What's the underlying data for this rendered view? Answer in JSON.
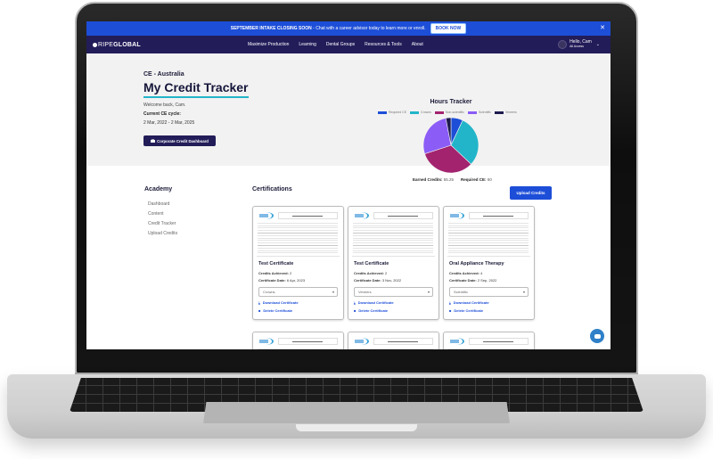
{
  "promo": {
    "headline": "SEPTEMBER INTAKE CLOSING SOON",
    "message": " - Chat with a career advisor today to learn more or enroll.",
    "cta": "BOOK NOW",
    "close": "✕"
  },
  "nav": {
    "logo_light": "RIPE",
    "logo_bold": "GLOBAL",
    "links": [
      "Maximize Production",
      "Learning",
      "Dental Groups",
      "Resources & Tools",
      "About"
    ],
    "user_greeting": "Hello, Cam",
    "user_sub": "All Access",
    "chevron": "⌄"
  },
  "hero": {
    "subtitle": "CE - Australia",
    "title": "My Credit Tracker",
    "welcome": "Welcome back, Cam.",
    "cycle_label": "Current CE cycle:",
    "cycle_value": "2 Mar, 2022 - 2 Mar, 2025",
    "dashboard_button": "Corporate Credit Dashboard"
  },
  "tracker": {
    "earned_label": "Earned Credits:",
    "earned_value": "55.25",
    "required_label": "Required CE:",
    "required_value": "60"
  },
  "chart_data": {
    "type": "pie",
    "title": "Hours Tracker",
    "legend_position": "top",
    "categories": [
      "Required CE",
      "Crowns",
      "Non-scientific",
      "Scientific",
      "Veneers"
    ],
    "values": [
      7,
      30,
      33,
      27,
      3
    ],
    "colors": [
      "#1d4ed8",
      "#22b5c9",
      "#a3236f",
      "#8b5cf6",
      "#1c1a4d"
    ]
  },
  "sidebar": {
    "heading": "Academy",
    "items": [
      "Dashboard",
      "Content",
      "Credit Tracker",
      "Upload Credits"
    ]
  },
  "certifications": {
    "heading": "Certifications",
    "upload_button": "Upload Credits",
    "credits_label": "Credits Achieved:",
    "date_label": "Certificate Date:",
    "download_label": "Download Certificate",
    "delete_label": "Delete Certificate",
    "cards": [
      {
        "title": "Test Certificate",
        "credits": "2",
        "date": "6 Apr, 2023",
        "category": "Crowns"
      },
      {
        "title": "Test Certificate",
        "credits": "2",
        "date": "3 Nov, 2022",
        "category": "Veneers"
      },
      {
        "title": "Oral Appliance Therapy",
        "credits": "4",
        "date": "2 Sep, 2022",
        "category": "Scientific"
      }
    ]
  }
}
